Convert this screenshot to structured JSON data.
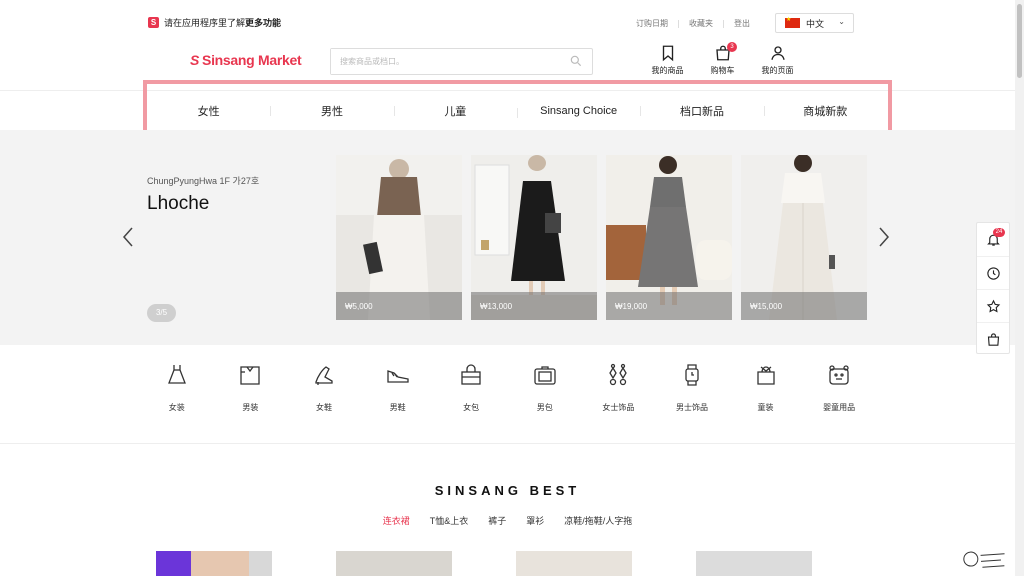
{
  "topbar": {
    "promo_text": "请在应用程序里了解",
    "promo_bold": "更多功能",
    "links": [
      "订购日期",
      "收藏夹",
      "登出"
    ],
    "language": "中文"
  },
  "header": {
    "logo_text": "Sinsang Market",
    "search_placeholder": "搜索商品或档口。",
    "icons": [
      {
        "label": "我的商品",
        "icon": "bookmark-icon"
      },
      {
        "label": "购物车",
        "icon": "shopping-bag-icon",
        "badge": "3"
      },
      {
        "label": "我的页面",
        "icon": "user-icon"
      }
    ]
  },
  "nav": {
    "categories": [
      "女性",
      "男性",
      "儿童",
      "Sinsang Choice",
      "档口新品",
      "商城新款"
    ]
  },
  "hero": {
    "store_location": "ChungPyungHwa 1F 가27호",
    "store_name": "Lhoche",
    "pager": "3/5",
    "products": [
      {
        "price": "₩5,000"
      },
      {
        "price": "₩13,000"
      },
      {
        "price": "₩19,000"
      },
      {
        "price": "₩15,000"
      }
    ]
  },
  "side_panel": {
    "notification_count": "24"
  },
  "category_icons": [
    {
      "label": "女装",
      "icon": "dress-icon"
    },
    {
      "label": "男装",
      "icon": "shirt-icon"
    },
    {
      "label": "女鞋",
      "icon": "heel-icon"
    },
    {
      "label": "男鞋",
      "icon": "sneaker-icon"
    },
    {
      "label": "女包",
      "icon": "handbag-icon"
    },
    {
      "label": "男包",
      "icon": "briefcase-icon"
    },
    {
      "label": "女士饰品",
      "icon": "earrings-icon"
    },
    {
      "label": "男士饰品",
      "icon": "watch-icon"
    },
    {
      "label": "童装",
      "icon": "kids-clothes-icon"
    },
    {
      "label": "婴童用品",
      "icon": "baby-goods-icon"
    }
  ],
  "best": {
    "title": "SINSANG BEST",
    "tabs": [
      "连衣裙",
      "T恤&上衣",
      "裤子",
      "罩衫",
      "凉鞋/拖鞋/人字拖"
    ]
  }
}
